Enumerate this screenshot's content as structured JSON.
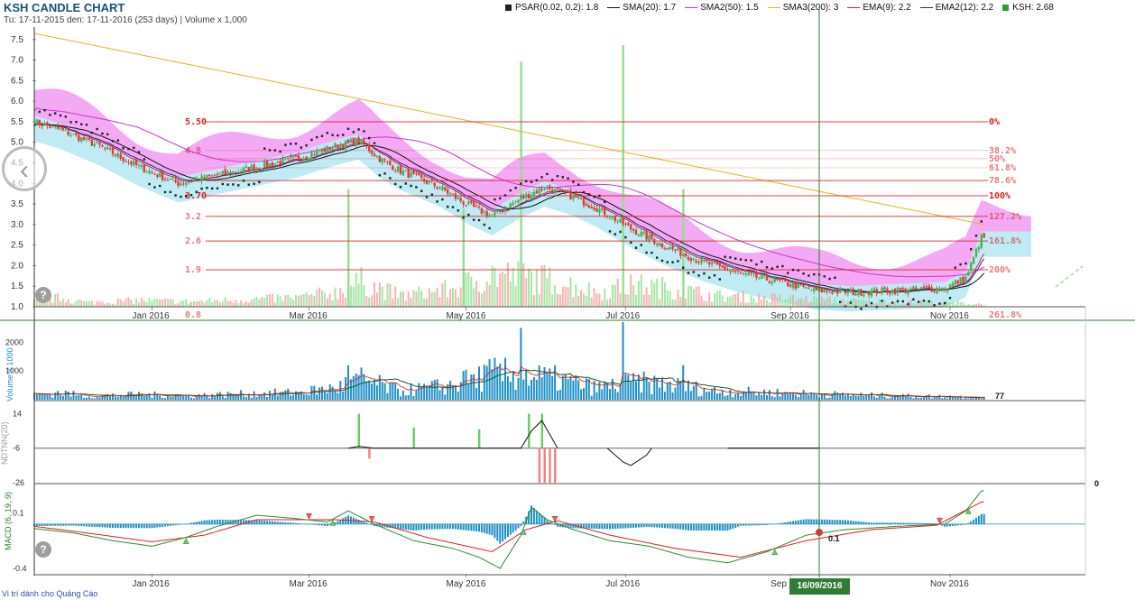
{
  "header": {
    "title": "KSH CANDLE CHART",
    "subtitle": "Tu: 17-11-2015 den: 17-11-2016 (253 days) | Volume x 1,000"
  },
  "legend": [
    {
      "label": "PSAR(0.02, 0.2): 1.8",
      "color": "#222222",
      "kind": "square"
    },
    {
      "label": "SMA(20): 1.7",
      "color": "#111111",
      "kind": "line"
    },
    {
      "label": "SMA2(50): 1.5",
      "color": "#cc33cc",
      "kind": "line"
    },
    {
      "label": "SMA3(200): 3",
      "color": "#e6b422",
      "kind": "line"
    },
    {
      "label": "EMA(9): 2.2",
      "color": "#e02020",
      "kind": "line"
    },
    {
      "label": "EMA2(12): 2.2",
      "color": "#2020a0",
      "kind": "line"
    },
    {
      "label": "KSH: 2.68",
      "color": "#2e9e2e",
      "kind": "square"
    }
  ],
  "footer": {
    "ad_text": "Vi trí dành cho Quảng Cáo"
  },
  "cursor": {
    "date_label": "16/09/2016",
    "macd_readout": "0.1"
  },
  "colors": {
    "up": "#4caf50",
    "down": "#e53935",
    "cloud_pink": "#f08cf0",
    "cloud_blue": "#a8e4f0",
    "sma200": "#e6b422",
    "sma50": "#cc33cc",
    "macd_line": "#2e8b2e",
    "macd_signal": "#e02020",
    "macd_hist": "#1e90c8",
    "volume_bar": "#1e90c8",
    "fib": "#e02020",
    "cursor": "#2e7d32"
  },
  "icons": {
    "nav_prev": "chevron-left-icon",
    "help": "help-icon"
  },
  "chart_data": [
    {
      "type": "candlestick",
      "title": "KSH CANDLE CHART",
      "x_tick_labels": [
        "Jan 2016",
        "Mar 2016",
        "May 2016",
        "Jul 2016",
        "Sep 2016",
        "Nov 2016"
      ],
      "x_tick_days": [
        45,
        105,
        165,
        226,
        289,
        350
      ],
      "y_ticks": [
        "1.0",
        "1.5",
        "2.0",
        "2.5",
        "3.0",
        "3.5",
        "4.0",
        "4.5",
        "5.0",
        "5.5",
        "6.0",
        "6.5",
        "7.0",
        "7.5"
      ],
      "ylim": [
        1.0,
        7.65
      ],
      "close_keypoints": [
        [
          0,
          5.5
        ],
        [
          10,
          5.3
        ],
        [
          25,
          4.9
        ],
        [
          40,
          4.4
        ],
        [
          55,
          4.0
        ],
        [
          70,
          4.2
        ],
        [
          85,
          4.4
        ],
        [
          100,
          4.6
        ],
        [
          115,
          4.9
        ],
        [
          124,
          5.05
        ],
        [
          132,
          4.6
        ],
        [
          140,
          4.3
        ],
        [
          155,
          3.9
        ],
        [
          165,
          3.5
        ],
        [
          175,
          3.2
        ],
        [
          185,
          3.6
        ],
        [
          195,
          3.9
        ],
        [
          205,
          3.7
        ],
        [
          215,
          3.4
        ],
        [
          228,
          2.9
        ],
        [
          240,
          2.5
        ],
        [
          255,
          2.1
        ],
        [
          270,
          1.8
        ],
        [
          285,
          1.6
        ],
        [
          298,
          1.4
        ],
        [
          312,
          1.35
        ],
        [
          330,
          1.4
        ],
        [
          348,
          1.45
        ],
        [
          356,
          1.7
        ],
        [
          362,
          2.68
        ]
      ],
      "fibonacci": {
        "left_labels": [
          {
            "text": "5.50",
            "y": 5.5
          },
          {
            "text": "4.8",
            "y": 4.8
          },
          {
            "text": "3.70",
            "y": 3.7
          },
          {
            "text": "3.2",
            "y": 3.2
          },
          {
            "text": "2.6",
            "y": 2.6
          },
          {
            "text": "1.9",
            "y": 1.9
          },
          {
            "text": "0.8",
            "y": 0.8
          }
        ],
        "levels": [
          {
            "label": "0%",
            "y": 5.5
          },
          {
            "label": "38.2%",
            "y": 4.8
          },
          {
            "label": "50%",
            "y": 4.6
          },
          {
            "label": "61.8%",
            "y": 4.38
          },
          {
            "label": "78.6%",
            "y": 4.07
          },
          {
            "label": "100%",
            "y": 3.7
          },
          {
            "label": "127.2%",
            "y": 3.2
          },
          {
            "label": "161.8%",
            "y": 2.6
          },
          {
            "label": "200%",
            "y": 1.9
          },
          {
            "label": "261.8%",
            "y": 0.8
          }
        ]
      },
      "psar_last": 1.8,
      "sma20_last": 1.7,
      "sma50_last": 1.5,
      "sma200_last": 3,
      "ema9_last": 2.2,
      "ema12_last": 2.2,
      "last": 2.68
    },
    {
      "type": "bar",
      "ylabel": "Volume x 1000",
      "y_ticks": [
        "1000",
        "2000"
      ],
      "ylim": [
        0,
        2700
      ],
      "last_value_label": "77",
      "volume_keypoints": [
        [
          0,
          150
        ],
        [
          10,
          250
        ],
        [
          20,
          120
        ],
        [
          40,
          180
        ],
        [
          60,
          140
        ],
        [
          80,
          200
        ],
        [
          100,
          250
        ],
        [
          115,
          400
        ],
        [
          125,
          700
        ],
        [
          140,
          300
        ],
        [
          160,
          500
        ],
        [
          175,
          900
        ],
        [
          190,
          800
        ],
        [
          200,
          700
        ],
        [
          215,
          400
        ],
        [
          230,
          600
        ],
        [
          245,
          500
        ],
        [
          260,
          300
        ],
        [
          280,
          250
        ],
        [
          300,
          200
        ],
        [
          320,
          150
        ],
        [
          340,
          120
        ],
        [
          355,
          100
        ],
        [
          362,
          77
        ]
      ],
      "spikes": [
        [
          186,
          2500
        ],
        [
          225,
          2700
        ],
        [
          120,
          1200
        ],
        [
          164,
          1000
        ],
        [
          248,
          1200
        ]
      ]
    },
    {
      "type": "bar",
      "ylabel": "NDTNN(20)",
      "y_ticks": [
        "14",
        "-6",
        "-26"
      ],
      "ylim": [
        -26,
        20
      ],
      "positive_spikes": [
        [
          124,
          14
        ],
        [
          145,
          6
        ],
        [
          170,
          5
        ],
        [
          189,
          14
        ],
        [
          194,
          14
        ]
      ],
      "negative_spikes": [
        [
          128,
          -12
        ],
        [
          131,
          -3
        ],
        [
          193,
          -26
        ],
        [
          195,
          -26
        ],
        [
          197,
          -26
        ],
        [
          199,
          -26
        ],
        [
          260,
          -3
        ],
        [
          340,
          -2
        ]
      ]
    },
    {
      "type": "line",
      "ylabel": "MACD (6, 19, 9)",
      "y_ticks": [
        "0.1",
        "-0.4"
      ],
      "ylim": [
        -0.45,
        0.35
      ],
      "macd_keypoints": [
        [
          0,
          -0.04
        ],
        [
          15,
          -0.08
        ],
        [
          30,
          -0.15
        ],
        [
          45,
          -0.2
        ],
        [
          58,
          -0.12
        ],
        [
          70,
          -0.02
        ],
        [
          85,
          0.08
        ],
        [
          100,
          0.05
        ],
        [
          112,
          0.02
        ],
        [
          120,
          0.12
        ],
        [
          130,
          0.0
        ],
        [
          145,
          -0.15
        ],
        [
          160,
          -0.22
        ],
        [
          170,
          -0.3
        ],
        [
          178,
          -0.4
        ],
        [
          186,
          -0.1
        ],
        [
          190,
          0.15
        ],
        [
          196,
          0.04
        ],
        [
          206,
          -0.05
        ],
        [
          220,
          -0.15
        ],
        [
          235,
          -0.2
        ],
        [
          250,
          -0.3
        ],
        [
          265,
          -0.35
        ],
        [
          280,
          -0.25
        ],
        [
          295,
          -0.1
        ],
        [
          310,
          -0.05
        ],
        [
          330,
          -0.02
        ],
        [
          348,
          0.0
        ],
        [
          356,
          0.12
        ],
        [
          362,
          0.3
        ]
      ],
      "signal_keypoints": [
        [
          0,
          -0.02
        ],
        [
          20,
          -0.08
        ],
        [
          45,
          -0.16
        ],
        [
          65,
          -0.1
        ],
        [
          85,
          0.04
        ],
        [
          115,
          0.04
        ],
        [
          130,
          0.02
        ],
        [
          150,
          -0.12
        ],
        [
          175,
          -0.25
        ],
        [
          188,
          -0.05
        ],
        [
          200,
          0.03
        ],
        [
          220,
          -0.1
        ],
        [
          245,
          -0.22
        ],
        [
          270,
          -0.3
        ],
        [
          295,
          -0.15
        ],
        [
          320,
          -0.05
        ],
        [
          345,
          -0.01
        ],
        [
          362,
          0.2
        ]
      ]
    }
  ]
}
